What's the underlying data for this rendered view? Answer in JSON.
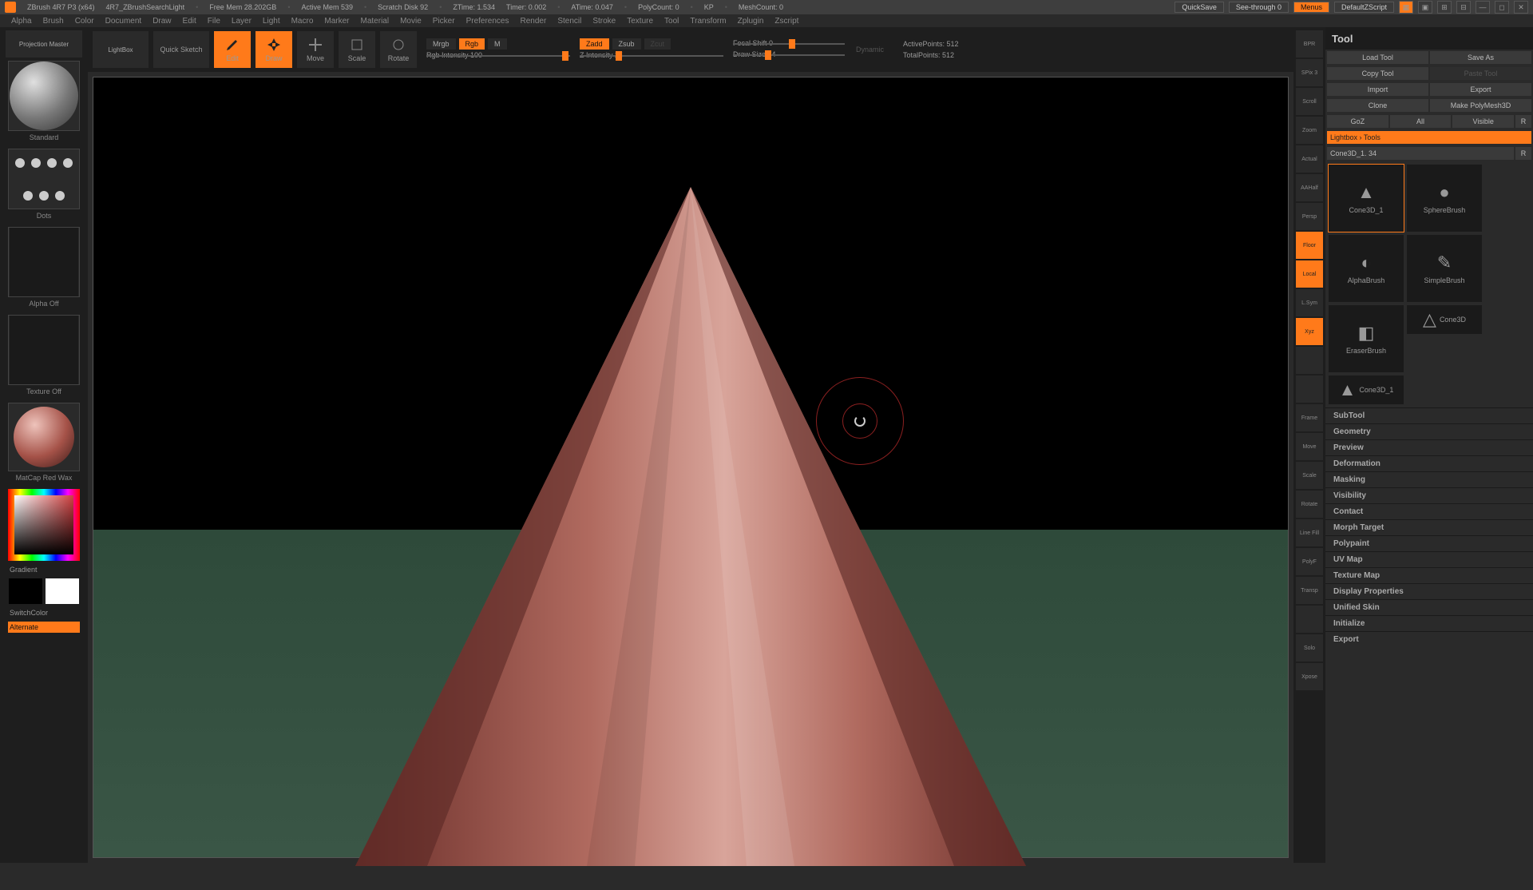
{
  "info": {
    "app": "ZBrush 4R7 P3 (x64)",
    "doc": "4R7_ZBrushSearchLight",
    "free_mem": "Free Mem 28.202GB",
    "active_mem": "Active Mem 539",
    "scratch": "Scratch Disk 92",
    "ztime": "ZTime: 1.534",
    "timer": "Timer: 0.002",
    "atime": "ATime: 0.047",
    "polycount": "PolyCount: 0",
    "kp": "KP",
    "meshcount": "MeshCount: 0",
    "quicksave": "QuickSave",
    "seethrough": "See-through   0",
    "menus": "Menus",
    "script": "DefaultZScript"
  },
  "menus": [
    "Alpha",
    "Brush",
    "Color",
    "Document",
    "Draw",
    "Edit",
    "File",
    "Layer",
    "Light",
    "Macro",
    "Marker",
    "Material",
    "Movie",
    "Picker",
    "Preferences",
    "Render",
    "Stencil",
    "Stroke",
    "Texture",
    "Tool",
    "Transform",
    "Zplugin",
    "Zscript"
  ],
  "left": {
    "projection": "Projection Master",
    "lightbox": "LightBox",
    "brush_lbl": "Standard",
    "stroke_lbl": "Dots",
    "alpha_lbl": "Alpha Off",
    "tex_lbl": "Texture Off",
    "mat_lbl": "MatCap Red Wax",
    "gradient": "Gradient",
    "switch": "SwitchColor",
    "alternate": "Alternate"
  },
  "toolbar": {
    "quicksketch": "Quick Sketch",
    "edit": "Edit",
    "draw": "Draw",
    "move": "Move",
    "scale": "Scale",
    "rotate": "Rotate",
    "mrgb": "Mrgb",
    "rgb": "Rgb",
    "m": "M",
    "rgb_int": "Rgb Intensity 100",
    "zadd": "Zadd",
    "zsub": "Zsub",
    "zcut": "Zcut",
    "z_int": "Z Intensity 25",
    "focal": "Focal Shift 0",
    "draw_size": "Draw Size 64",
    "dynamic": "Dynamic",
    "active_pts": "ActivePoints: 512",
    "total_pts": "TotalPoints: 512"
  },
  "strip": [
    "BPR",
    "SPix 3",
    "Scroll",
    "Zoom",
    "Actual",
    "AAHalf",
    "Persp",
    "Floor",
    "Local",
    "L.Sym",
    "Xyz",
    "",
    "",
    "Frame",
    "Move",
    "Scale",
    "Rotate",
    "Line Fill",
    "PolyF",
    "Transp",
    "",
    "Solo",
    "Xpose"
  ],
  "strip_active": [
    false,
    false,
    false,
    false,
    false,
    false,
    false,
    true,
    true,
    false,
    true,
    false,
    false,
    false,
    false,
    false,
    false,
    false,
    false,
    false,
    false,
    false,
    false
  ],
  "tool": {
    "title": "Tool",
    "row1": [
      "Load Tool",
      "Save As"
    ],
    "row2": [
      "Copy Tool",
      "Paste Tool"
    ],
    "row3": [
      "Import",
      "Export"
    ],
    "row4": [
      "Clone",
      "Make PolyMesh3D"
    ],
    "row5": [
      "GoZ",
      "All",
      "Visible",
      "R"
    ],
    "lightbox_tools": "Lightbox › Tools",
    "current": "Cone3D_1. 34",
    "r": "R",
    "thumbs": [
      "Cone3D_1",
      "SphereBrush",
      "AlphaBrush",
      "SimpleBrush",
      "EraserBrush",
      "Cone3D",
      "Cone3D_1"
    ],
    "sections": [
      "SubTool",
      "Geometry",
      "Preview",
      "Deformation",
      "Masking",
      "Visibility",
      "Contact",
      "Morph Target",
      "Polypaint",
      "UV Map",
      "Texture Map",
      "Display Properties",
      "Unified Skin",
      "Initialize",
      "Export"
    ]
  }
}
